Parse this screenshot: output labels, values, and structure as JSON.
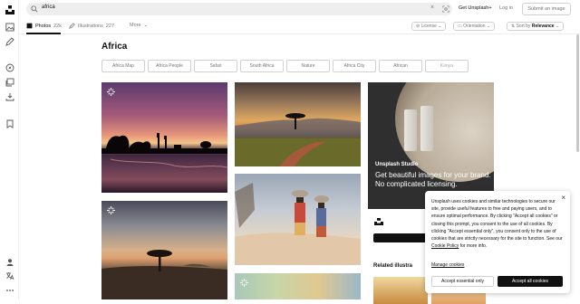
{
  "search": {
    "query": "africa",
    "clear": "×"
  },
  "topbar": {
    "get_unsplash": "Get Unsplash+",
    "login": "Log in",
    "submit": "Submit an image"
  },
  "tabs": [
    {
      "label": "Photos",
      "count": "22k"
    },
    {
      "label": "Illustrations",
      "count": "227"
    }
  ],
  "more": "More",
  "filters": {
    "license": "License",
    "orientation": "Orientation",
    "sort": "Sort by",
    "sort_value": "Relevance"
  },
  "page_title": "Africa",
  "related_searches": [
    "Africa Map",
    "Africa People",
    "Safari",
    "South Africa",
    "Nature",
    "Africa City",
    "African",
    "Kenya"
  ],
  "promo": {
    "brand": "Unsplash Studio",
    "headline": "Get beautiful images for your brand. No complicated licensing."
  },
  "below_promo": {
    "cta": "Le",
    "related_title": "Related illustra"
  },
  "cookie": {
    "close": "×",
    "message_before": "Unsplash uses cookies and similar technologies to secure our site, provide useful features to free and paying users, and to ensure optimal performance. By clicking \"Accept all cookies\" or closing this prompt, you consent to the use of all cookies. By clicking \"Accept essential only\", you consent only to the use of cookies that are strictly necessary for the site to function. See our ",
    "policy_link": "Cookie Policy",
    "message_after": " for more info.",
    "manage": "Manage cookies",
    "essential": "Accept essential only",
    "accept_all": "Accept all cookies"
  },
  "icons": {
    "sidebar": [
      "unsplash-logo-icon",
      "image-icon",
      "pen-icon",
      "compass-icon",
      "collections-icon",
      "download-icon",
      "bookmark-icon",
      "user-icon",
      "language-icon",
      "more-icon"
    ]
  },
  "colors": {
    "accent": "#111111",
    "muted": "#767676",
    "border": "#d1d1d1"
  }
}
